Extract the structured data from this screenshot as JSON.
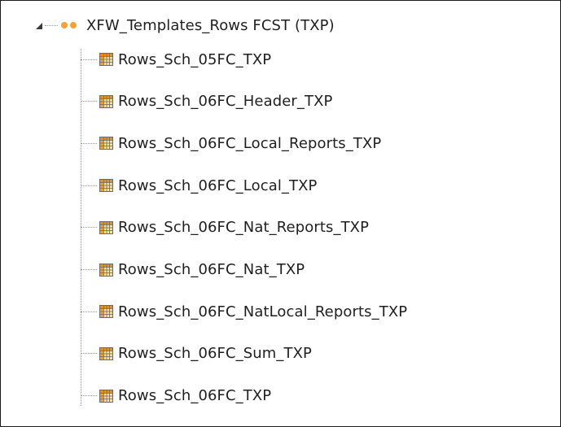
{
  "tree": {
    "root": {
      "label": "XFW_Templates_Rows FCST (TXP)",
      "expanded": true,
      "icon": "orange-dots-icon"
    },
    "children": [
      {
        "label": "Rows_Sch_05FC_TXP",
        "icon": "table-icon"
      },
      {
        "label": "Rows_Sch_06FC_Header_TXP",
        "icon": "table-icon"
      },
      {
        "label": "Rows_Sch_06FC_Local_Reports_TXP",
        "icon": "table-icon"
      },
      {
        "label": "Rows_Sch_06FC_Local_TXP",
        "icon": "table-icon"
      },
      {
        "label": "Rows_Sch_06FC_Nat_Reports_TXP",
        "icon": "table-icon"
      },
      {
        "label": "Rows_Sch_06FC_Nat_TXP",
        "icon": "table-icon"
      },
      {
        "label": "Rows_Sch_06FC_NatLocal_Reports_TXP",
        "icon": "table-icon"
      },
      {
        "label": "Rows_Sch_06FC_Sum_TXP",
        "icon": "table-icon"
      },
      {
        "label": "Rows_Sch_06FC_TXP",
        "icon": "table-icon"
      }
    ]
  },
  "colors": {
    "accent_orange": "#f3a23a",
    "icon_header_orange": "#e8901e",
    "icon_cell_yellow": "#ffe08a",
    "text": "#1f1f1f",
    "tree_lines": "#9a9a9a",
    "border": "#1a1a1a"
  }
}
